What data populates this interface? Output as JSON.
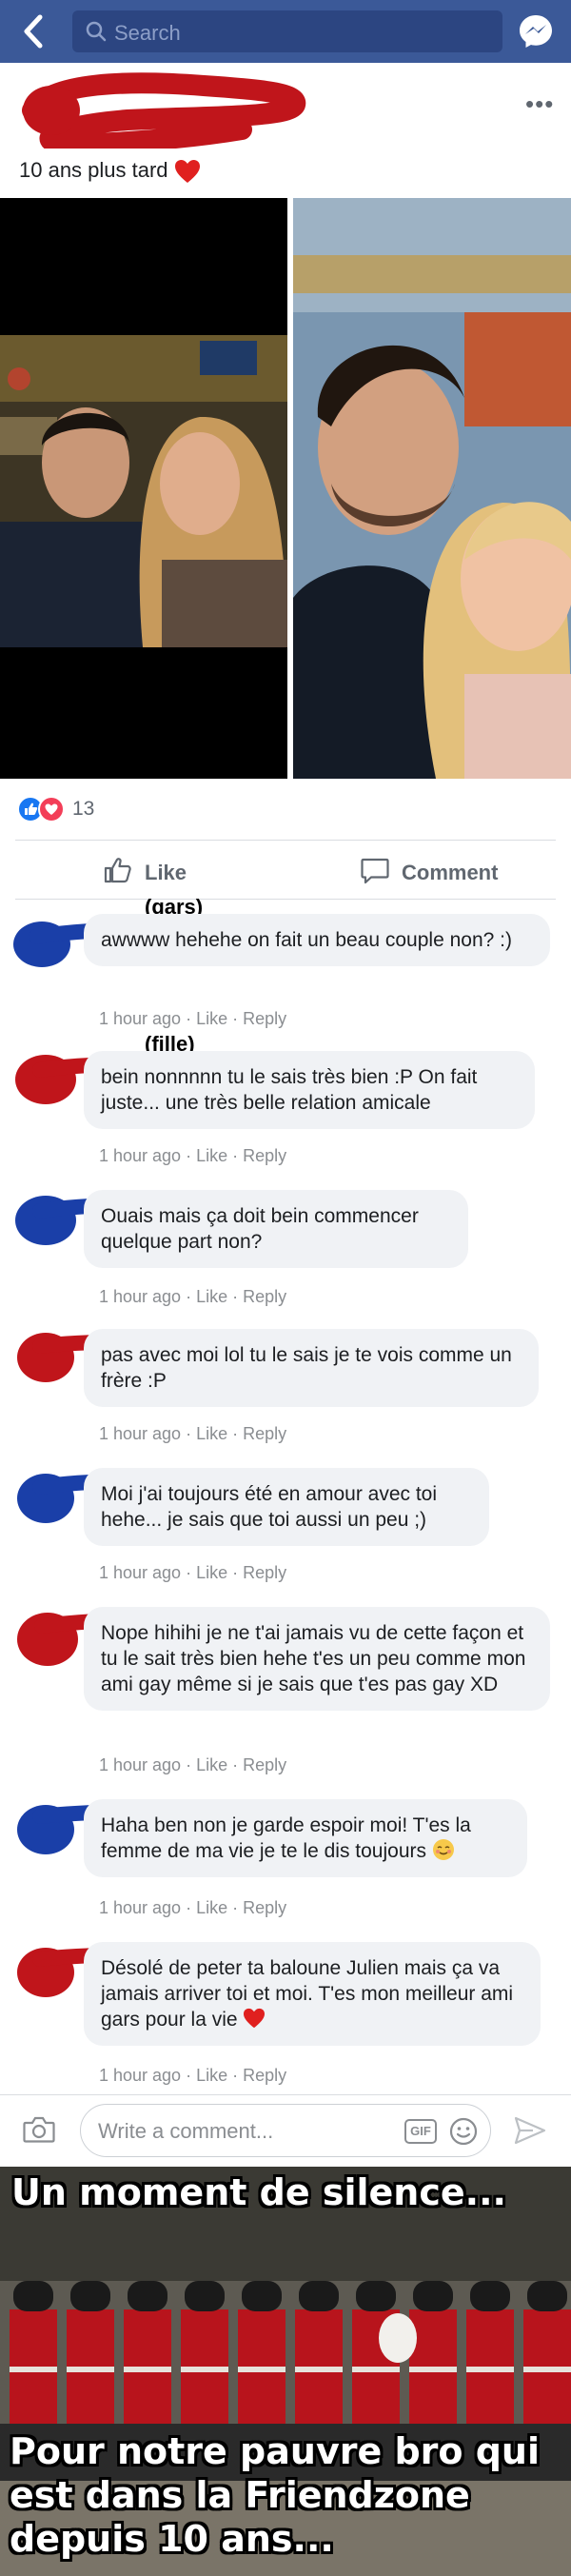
{
  "topbar": {
    "search_placeholder": "Search",
    "back_icon": "chevron-left-icon",
    "messenger_icon": "messenger-icon",
    "color": "#3b5998"
  },
  "post": {
    "text": "10 ans plus tard",
    "more_label": "•••",
    "reaction_count": "13"
  },
  "actions": {
    "like_label": "Like",
    "comment_label": "Comment"
  },
  "comments": [
    {
      "tag": "(gars)",
      "text": "awwww hehehe on fait un beau couple non? :)",
      "meta": "1 hour ago · Like · Reply",
      "color": "#1a3fa8"
    },
    {
      "tag": "(fille)",
      "text": "bein nonnnnn tu le sais très bien :P On fait juste... une très belle relation amicale",
      "meta": "1 hour ago · Like · Reply",
      "color": "#c0151b"
    },
    {
      "tag": "",
      "text": "Ouais mais ça doit bein commencer quelque part non?",
      "meta": "1 hour ago · Like · Reply",
      "color": "#1a3fa8"
    },
    {
      "tag": "",
      "text": "pas avec moi lol tu le sais je te vois comme un frère :P",
      "meta": "1 hour ago · Like · Reply",
      "color": "#c0151b"
    },
    {
      "tag": "",
      "text": "Moi j'ai toujours été en amour avec toi hehe... je sais que toi aussi un peu ;)",
      "meta": "1 hour ago · Like · Reply",
      "color": "#1a3fa8"
    },
    {
      "tag": "",
      "text": "Nope hihihi je ne t'ai jamais vu de cette façon et tu le sait très bien hehe t'es un peu comme mon ami gay même si je sais que t'es pas gay XD",
      "meta": "1 hour ago · Like · Reply",
      "color": "#c0151b"
    },
    {
      "tag": "",
      "text": "Haha ben non je garde espoir moi! T'es la femme de ma vie je te le dis toujours",
      "meta": "1 hour ago · Like · Reply",
      "color": "#1a3fa8"
    },
    {
      "tag": "",
      "text": "Désolé de peter ta baloune Julien mais ça va jamais arriver toi et moi. T'es mon meilleur ami gars pour la vie",
      "meta": "1 hour ago · Like · Reply",
      "color": "#c0151b"
    }
  ],
  "composer": {
    "placeholder": "Write a comment...",
    "gif_label": "GIF"
  },
  "meme": {
    "top_text": "Un moment de silence...",
    "bottom_line1": "Pour notre pauvre bro qui",
    "bottom_line2": "est dans la Friendzone",
    "bottom_line3": "depuis 10 ans..."
  }
}
